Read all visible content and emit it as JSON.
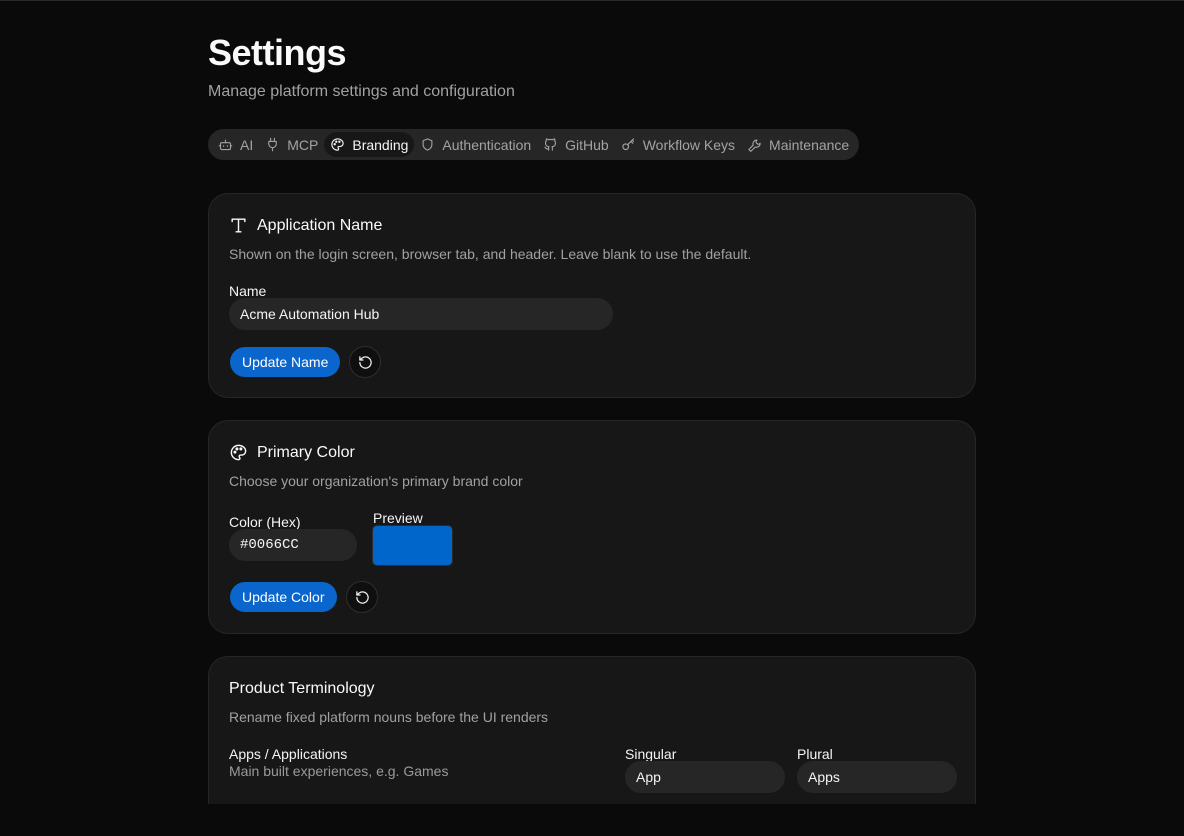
{
  "page": {
    "title": "Settings",
    "subtitle": "Manage platform settings and configuration"
  },
  "tabs": [
    {
      "label": "AI",
      "icon": "bot-icon"
    },
    {
      "label": "MCP",
      "icon": "plug-icon"
    },
    {
      "label": "Branding",
      "icon": "palette-icon",
      "active": true
    },
    {
      "label": "Authentication",
      "icon": "shield-icon"
    },
    {
      "label": "GitHub",
      "icon": "github-icon"
    },
    {
      "label": "Workflow Keys",
      "icon": "key-icon"
    },
    {
      "label": "Maintenance",
      "icon": "wrench-icon"
    }
  ],
  "app_name": {
    "title": "Application Name",
    "icon": "type-icon",
    "description": "Shown on the login screen, browser tab, and header. Leave blank to use the default.",
    "field_label": "Name",
    "field_value": "Acme Automation Hub",
    "button_label": "Update Name",
    "reset_icon": "reset-icon"
  },
  "primary_color": {
    "title": "Primary Color",
    "icon": "palette-icon",
    "description": "Choose your organization's primary brand color",
    "field_label": "Color (Hex)",
    "field_value": "#0066CC",
    "preview_label": "Preview",
    "preview_color": "#0066CC",
    "button_label": "Update Color",
    "reset_icon": "reset-icon"
  },
  "terminology": {
    "title": "Product Terminology",
    "description": "Rename fixed platform nouns before the UI renders",
    "rows": [
      {
        "name": "Apps / Applications",
        "hint": "Main built experiences, e.g. Games",
        "singular_label": "Singular",
        "singular_value": "App",
        "plural_label": "Plural",
        "plural_value": "Apps"
      }
    ]
  },
  "colors": {
    "background": "#0a0a0a",
    "card": "#171717",
    "accent": "#0a66cc"
  }
}
